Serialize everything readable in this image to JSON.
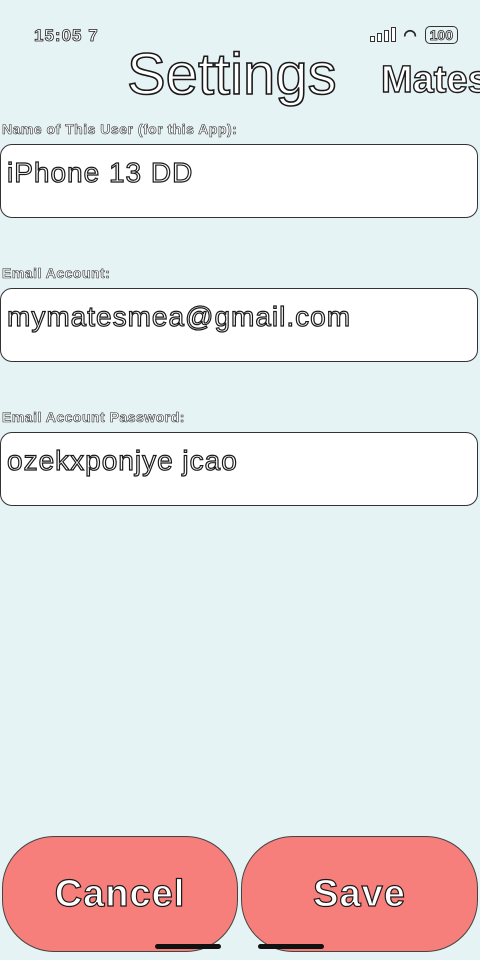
{
  "status_bar": {
    "time": "15:05 7",
    "battery": "100"
  },
  "header": {
    "title": "Settings",
    "mates_link": "Mates"
  },
  "fields": [
    {
      "label": "Name of This User (for this App):",
      "value": "iPhone 13 DD"
    },
    {
      "label": "Email Account:",
      "value": "mymatesmea@gmail.com"
    },
    {
      "label": "Email Account Password:",
      "value": "ozekxponjye jcao"
    }
  ],
  "buttons": {
    "cancel": "Cancel",
    "save": "Save"
  },
  "colors": {
    "background": "#e6f3f5",
    "button": "#f77f7b",
    "field": "#ffffff"
  },
  "icons": [
    "signal-icon",
    "wifi-icon",
    "battery-icon"
  ]
}
